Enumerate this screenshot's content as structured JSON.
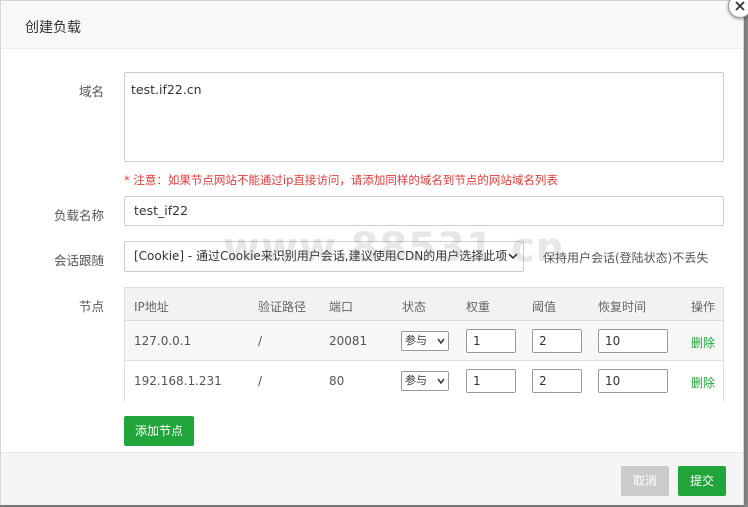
{
  "dialog": {
    "title": "创建负载",
    "close_icon": "close-icon"
  },
  "form": {
    "domain_label": "域名",
    "domain_value": "test.if22.cn",
    "domain_notice": "* 注意：如果节点网站不能通过ip直接访问，请添加同样的域名到节点的网站域名列表",
    "name_label": "负载名称",
    "name_value": "test_if22",
    "session_label": "会话跟随",
    "session_value": "[Cookie] - 通过Cookie来识别用户会话,建议使用CDN的用户选择此项",
    "session_hint": "保持用户会话(登陆状态)不丢失",
    "nodes_label": "节点"
  },
  "nodes_table": {
    "columns": [
      "IP地址",
      "验证路径",
      "端口",
      "状态",
      "权重",
      "阈值",
      "恢复时间",
      "操作"
    ],
    "rows": [
      {
        "ip": "127.0.0.1",
        "path": "/",
        "port": "20081",
        "status": "参与",
        "weight": "1",
        "threshold": "2",
        "recovery": "10",
        "action": "删除"
      },
      {
        "ip": "192.168.1.231",
        "path": "/",
        "port": "80",
        "status": "参与",
        "weight": "1",
        "threshold": "2",
        "recovery": "10",
        "action": "删除"
      }
    ]
  },
  "buttons": {
    "add_node": "添加节点",
    "cancel": "取消",
    "submit": "提交"
  },
  "watermark": "www.88531.cn",
  "colors": {
    "accent": "#20a53a",
    "notice": "#e23a3a",
    "cancel_bg": "#cbcbcb"
  }
}
